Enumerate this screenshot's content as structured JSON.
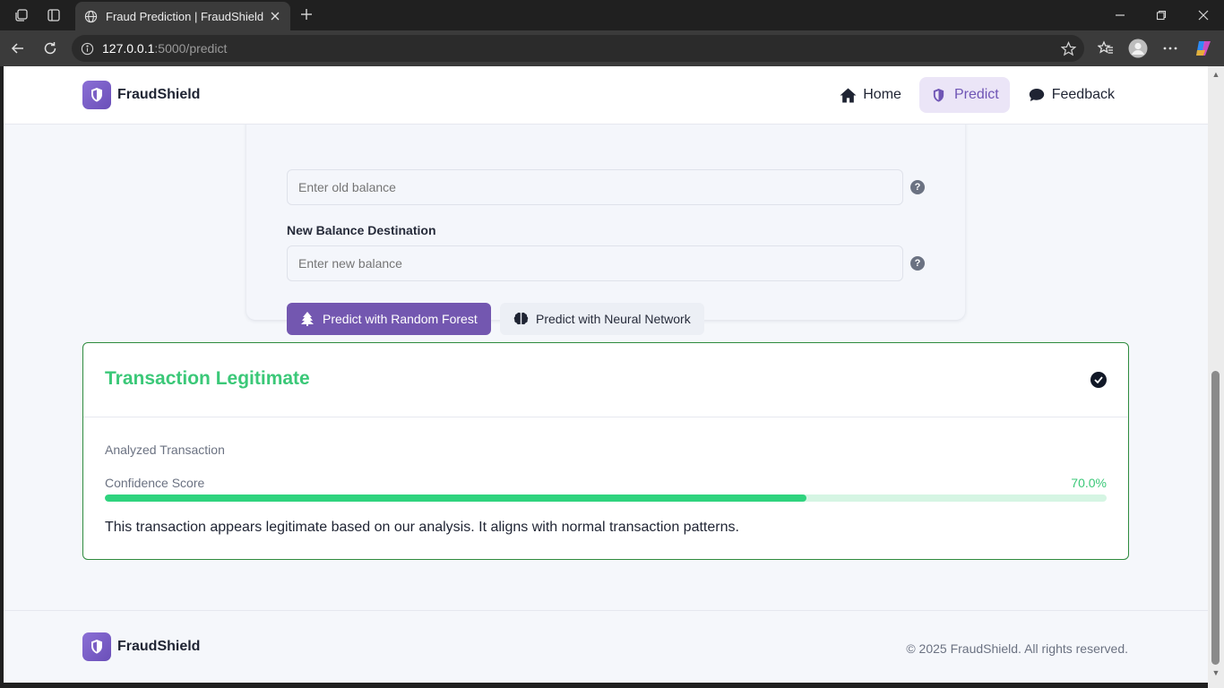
{
  "browser": {
    "tab_title": "Fraud Prediction | FraudShield",
    "url_host": "127.0.0.1",
    "url_rest": ":5000/predict"
  },
  "header": {
    "brand": "FraudShield",
    "nav": {
      "home": "Home",
      "predict": "Predict",
      "feedback": "Feedback"
    }
  },
  "form": {
    "old_balance_placeholder": "Enter old balance",
    "new_balance_label": "New Balance Destination",
    "new_balance_placeholder": "Enter new balance",
    "help_glyph": "?",
    "btn_random_forest": "Predict with Random Forest",
    "btn_neural_network": "Predict with Neural Network"
  },
  "result": {
    "title": "Transaction Legitimate",
    "analyzed_label": "Analyzed Transaction",
    "confidence_label": "Confidence Score",
    "confidence_text": "70.0%",
    "confidence_value": 70.0,
    "message": "This transaction appears legitimate based on our analysis. It aligns with normal transaction patterns."
  },
  "footer": {
    "brand": "FraudShield",
    "copyright": "© 2025 FraudShield. All rights reserved."
  },
  "colors": {
    "brand_purple": "#7357b0",
    "success_green": "#3bc878",
    "progress_fill": "#2fd37e",
    "progress_track": "#d5f5e3"
  }
}
